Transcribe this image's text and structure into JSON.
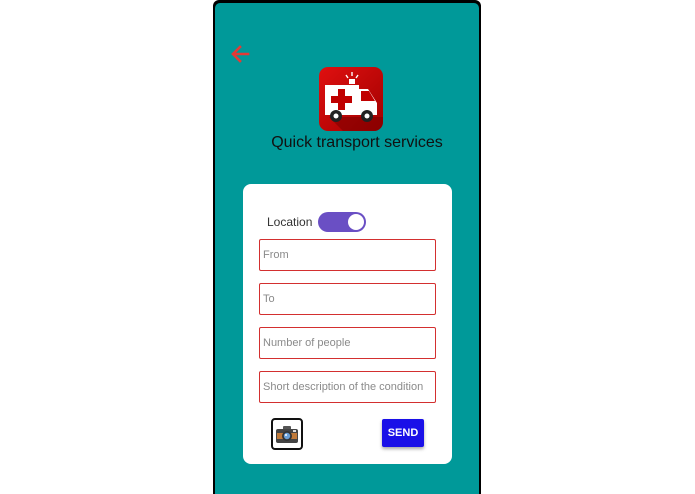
{
  "header": {
    "back_icon": "arrow-left-icon",
    "app_icon": "ambulance-icon",
    "title": "Quick transport services"
  },
  "form": {
    "location_label": "Location",
    "location_toggle_on": true,
    "fields": {
      "from_placeholder": "From",
      "to_placeholder": "To",
      "people_placeholder": "Number of people",
      "description_placeholder": "Short description of the condition"
    },
    "camera_icon": "camera-icon",
    "send_label": "SEND"
  },
  "colors": {
    "background": "#009999",
    "back_arrow": "#e53935",
    "toggle": "#6a4fc4",
    "field_border": "#d32f2f",
    "send_button": "#1a10e8"
  }
}
